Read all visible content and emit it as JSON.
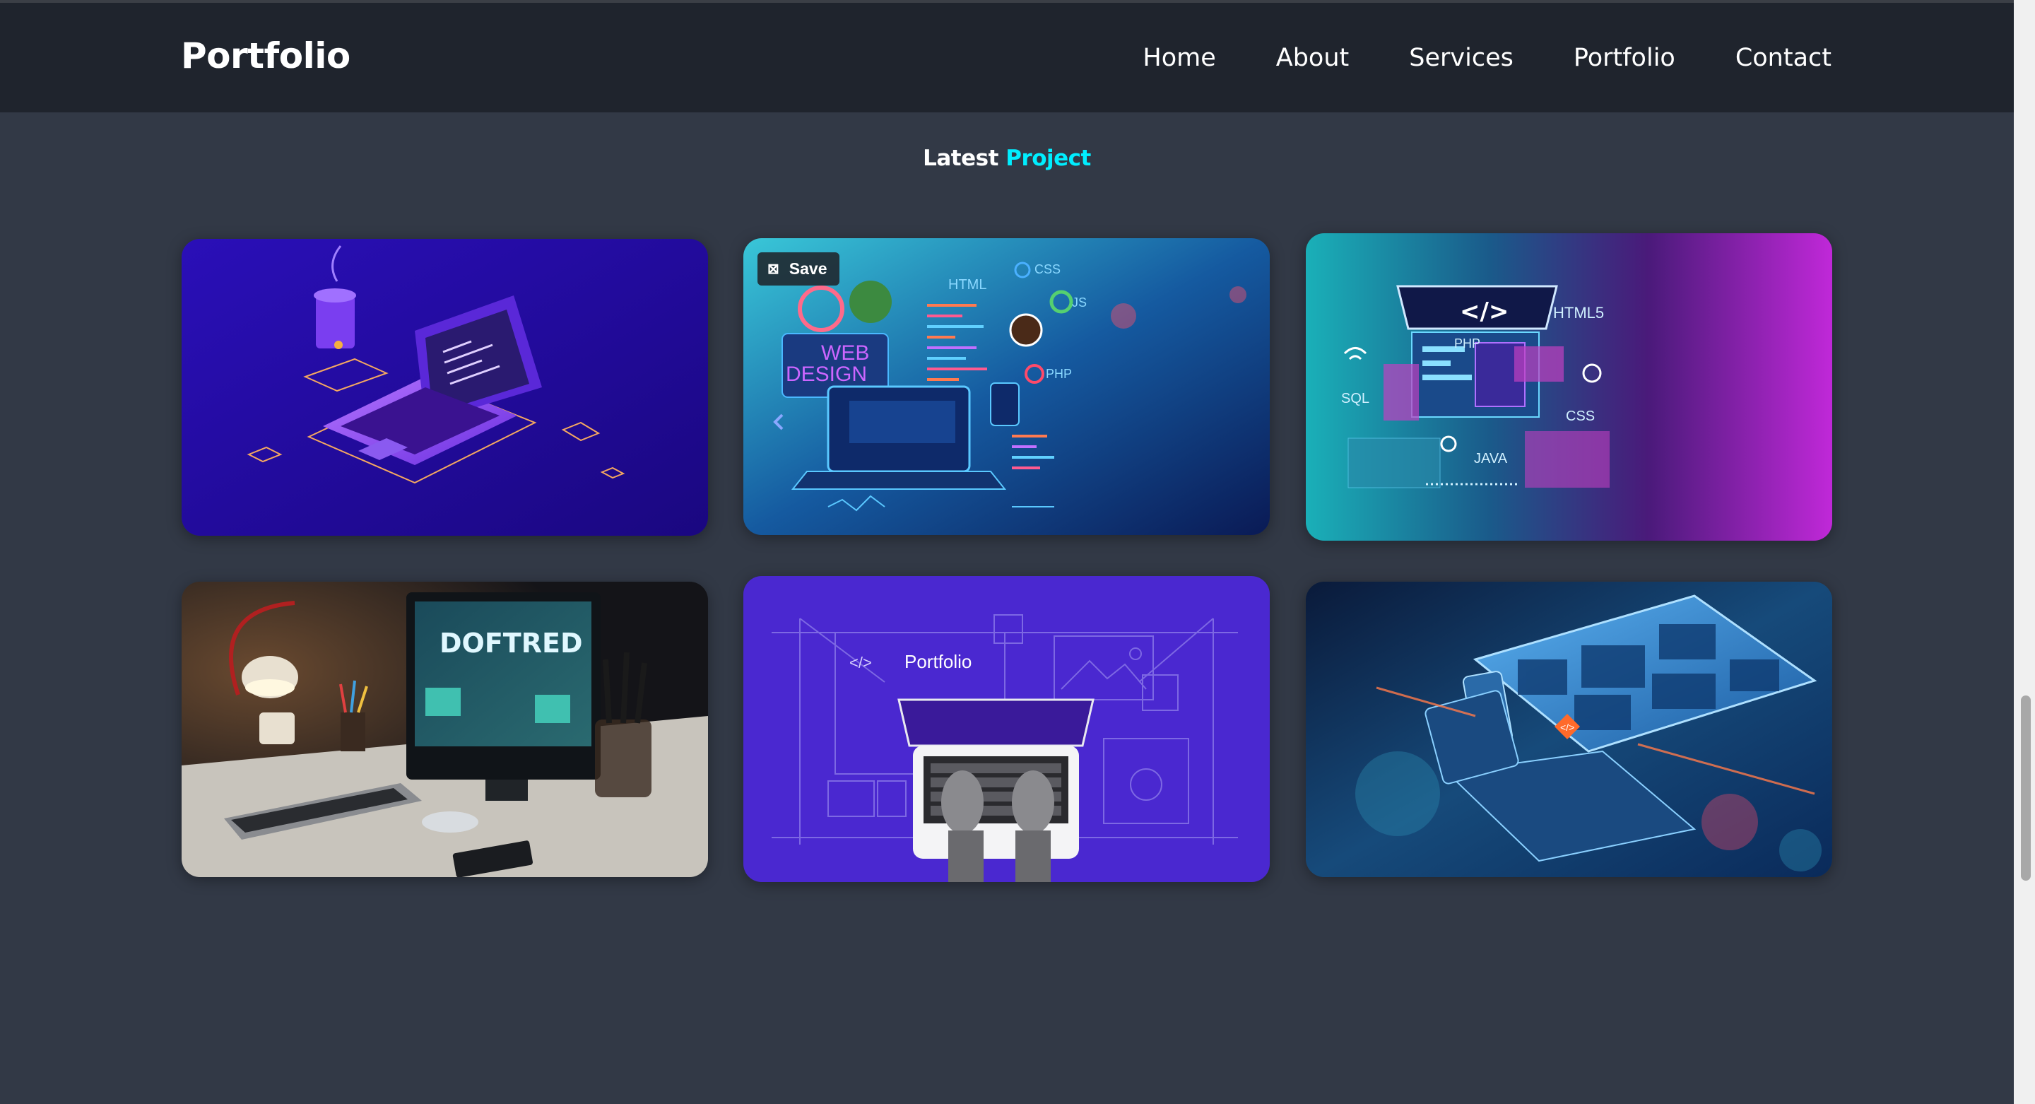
{
  "header": {
    "logo": "Portfolio",
    "nav": [
      "Home",
      "About",
      "Services",
      "Portfolio",
      "Contact"
    ]
  },
  "section": {
    "title_prefix": "Latest",
    "title_accent": "Project"
  },
  "overlay": {
    "save_label": "Save"
  },
  "cards": [
    {
      "name": "project-card-isometric-laptop",
      "texts": []
    },
    {
      "name": "project-card-web-design",
      "texts": [
        "WEB",
        "DESIGN",
        "HTML",
        "CSS",
        "JS",
        "PHP"
      ]
    },
    {
      "name": "project-card-code-laptop",
      "texts": [
        "HTML5",
        "PHP",
        "SQL",
        "CSS",
        "JAVA"
      ]
    },
    {
      "name": "project-card-desk-monitor",
      "texts": [
        "DOFTRED"
      ]
    },
    {
      "name": "project-card-portfolio-typing",
      "texts": [
        "Portfolio"
      ]
    },
    {
      "name": "project-card-devices",
      "texts": []
    }
  ],
  "colors": {
    "background": "#323946",
    "header": "#1f242d",
    "accent": "#00eeff"
  }
}
